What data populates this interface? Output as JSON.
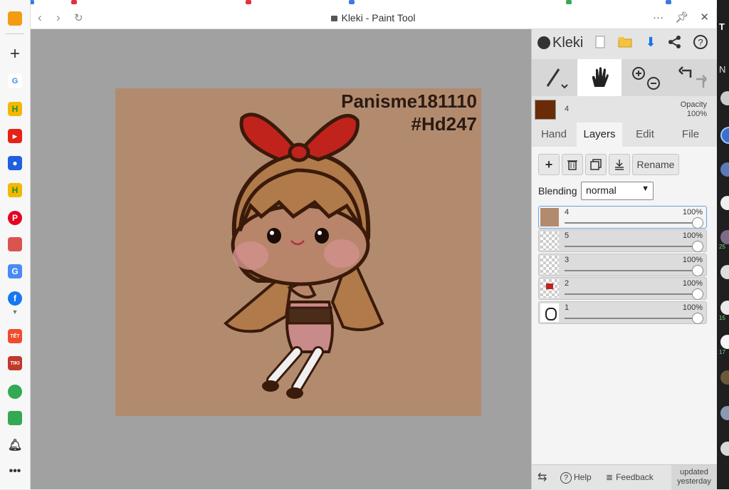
{
  "window": {
    "title": "Kleki - Paint Tool"
  },
  "canvas": {
    "watermark_line1": "Panisme181110",
    "watermark_line2": "#Hd247"
  },
  "app": {
    "brand": "Kleki"
  },
  "color": {
    "primary": "#6a2b08",
    "brush_size": "4",
    "opacity_label": "Opacity",
    "opacity_value": "100%"
  },
  "tabs": [
    {
      "label": "Hand"
    },
    {
      "label": "Layers"
    },
    {
      "label": "Edit"
    },
    {
      "label": "File"
    }
  ],
  "layers_panel": {
    "rename_label": "Rename",
    "blending_label": "Blending",
    "blending_value": "normal",
    "layers": [
      {
        "name": "4",
        "opacity": "100%"
      },
      {
        "name": "5",
        "opacity": "100%"
      },
      {
        "name": "3",
        "opacity": "100%"
      },
      {
        "name": "2",
        "opacity": "100%"
      },
      {
        "name": "1",
        "opacity": "100%"
      }
    ]
  },
  "bottom": {
    "help": "Help",
    "feedback": "Feedback",
    "updated_line1": "updated",
    "updated_line2": "yesterday"
  },
  "right_strip": {
    "label_t": "T",
    "label_n": "N",
    "badge_1": "25",
    "badge_2": "15",
    "badge_3": "17"
  },
  "sidebar_badges": {
    "tet": "TẾT",
    "tiki": "TIKI"
  }
}
